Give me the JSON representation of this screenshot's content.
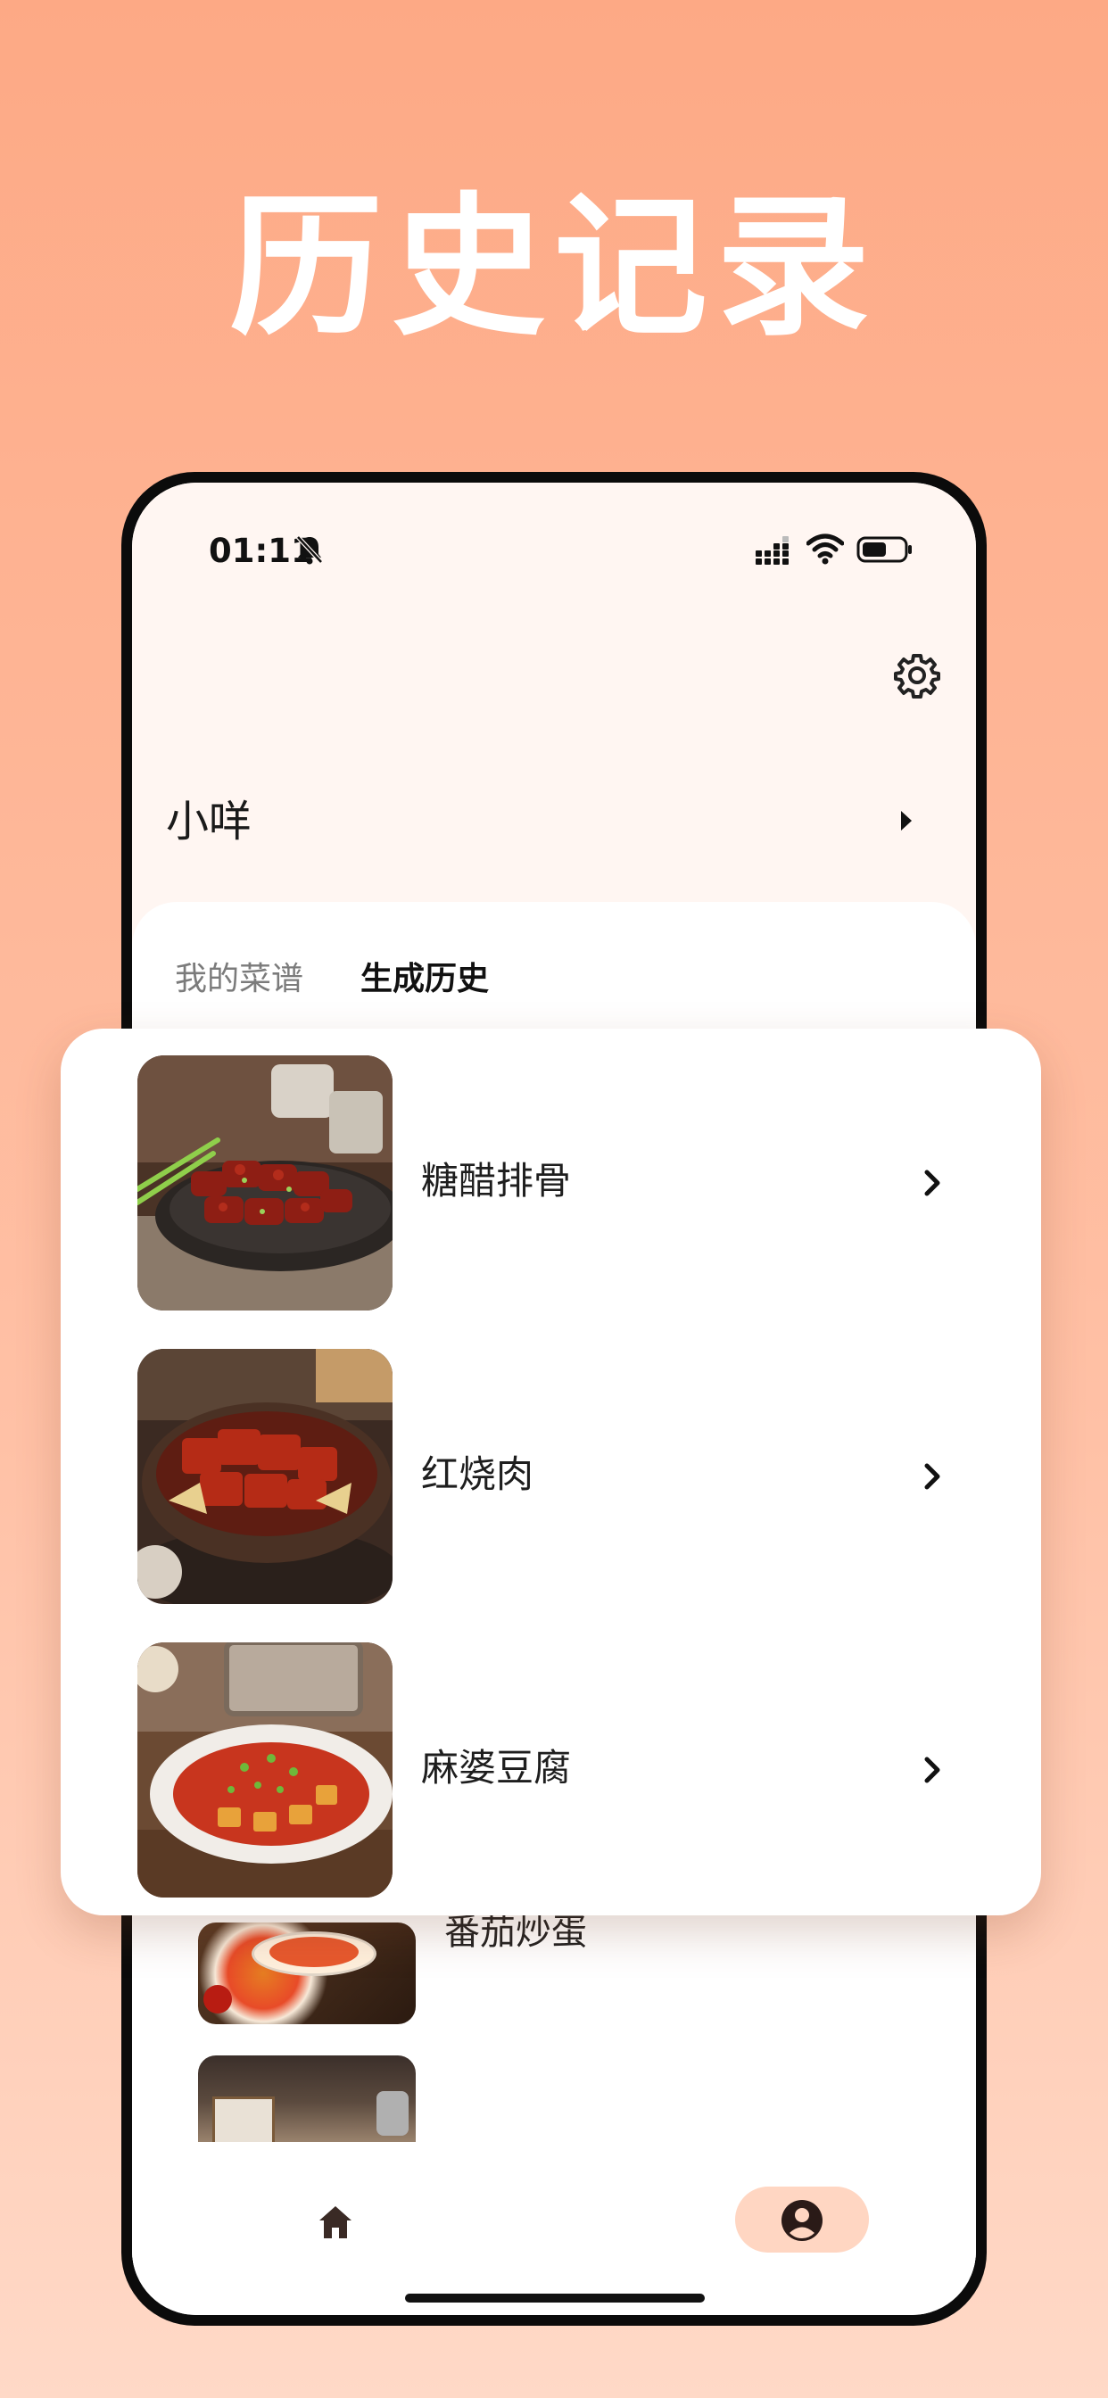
{
  "hero": {
    "title": "历史记录"
  },
  "status_bar": {
    "time": "01:11"
  },
  "profile": {
    "name": "小咩"
  },
  "tabs": [
    {
      "label": "我的菜谱",
      "active": false
    },
    {
      "label": "生成历史",
      "active": true
    }
  ],
  "history": {
    "items": [
      {
        "title": "糖醋排骨"
      },
      {
        "title": "红烧肉"
      },
      {
        "title": "麻婆豆腐"
      }
    ]
  },
  "background_list": {
    "partial_title": "番茄炒蛋"
  },
  "colors": {
    "background_top": "#fda985",
    "background_bottom": "#ffd9c7",
    "accent": "#ffd6c2",
    "text_primary": "#1e1e1e",
    "text_secondary": "#7b7b7b"
  },
  "icons": {
    "settings": "gear-icon",
    "profile_caret": "caret-right-icon",
    "item_chevron": "chevron-right-icon",
    "nav_home": "home-icon",
    "nav_profile": "person-circle-icon"
  }
}
